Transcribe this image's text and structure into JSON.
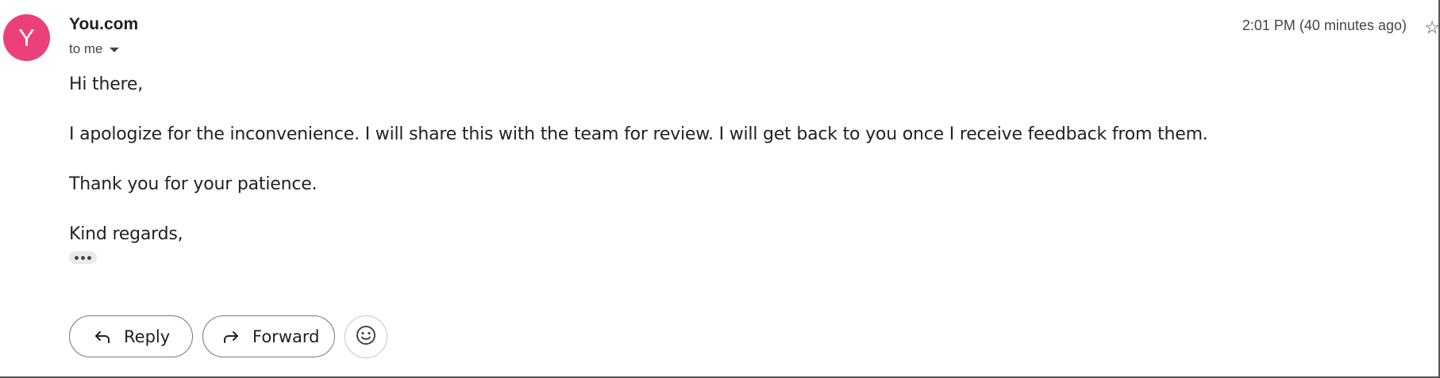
{
  "colors": {
    "avatar_bg": "#ec407a",
    "text_primary": "#1f1f1f",
    "text_secondary": "#444746"
  },
  "header": {
    "avatar_letter": "Y",
    "sender": "You.com",
    "recipient": "to me",
    "timestamp": "2:01 PM (40 minutes ago)",
    "icons": [
      "caret-down-icon",
      "star-icon"
    ]
  },
  "body": {
    "greeting": "Hi there,",
    "paragraph1": "I apologize for the inconvenience. I will share this with the team for review. I will get back to you once I receive feedback from them.",
    "paragraph2": "Thank you for your patience.",
    "closing": "Kind regards,"
  },
  "actions": {
    "reply_label": "Reply",
    "forward_label": "Forward",
    "icons": [
      "reply-arrow-icon",
      "forward-arrow-icon",
      "emoji-smile-icon",
      "more-dots-icon"
    ]
  }
}
